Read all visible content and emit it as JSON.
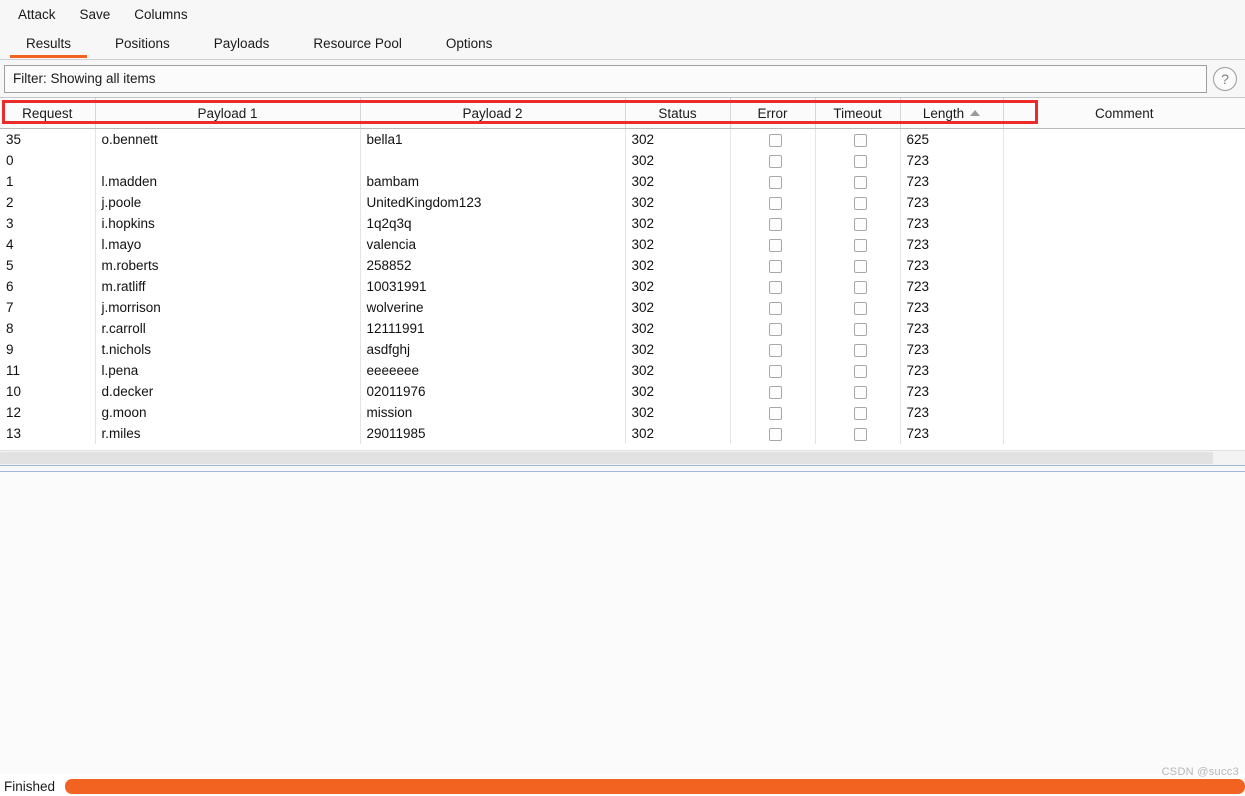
{
  "menubar": {
    "items": [
      {
        "label": "Attack",
        "name": "menu-attack"
      },
      {
        "label": "Save",
        "name": "menu-save"
      },
      {
        "label": "Columns",
        "name": "menu-columns"
      }
    ]
  },
  "tabs": {
    "items": [
      {
        "label": "Results",
        "active": true
      },
      {
        "label": "Positions",
        "active": false
      },
      {
        "label": "Payloads",
        "active": false
      },
      {
        "label": "Resource Pool",
        "active": false
      },
      {
        "label": "Options",
        "active": false
      }
    ],
    "active_accent": "#f26321"
  },
  "filter": {
    "text": "Filter: Showing all items",
    "help_icon": "question-mark-icon",
    "help_glyph": "?"
  },
  "table": {
    "columns": [
      {
        "label": "Request",
        "sort": ""
      },
      {
        "label": "Payload 1",
        "sort": ""
      },
      {
        "label": "Payload 2",
        "sort": ""
      },
      {
        "label": "Status",
        "sort": ""
      },
      {
        "label": "Error",
        "sort": ""
      },
      {
        "label": "Timeout",
        "sort": ""
      },
      {
        "label": "Length",
        "sort": "asc"
      },
      {
        "label": "Comment",
        "sort": ""
      }
    ],
    "rows": [
      {
        "request": "35",
        "payload1": "o.bennett",
        "payload2": "bella1",
        "status": "302",
        "error": false,
        "timeout": false,
        "length": "625",
        "comment": "",
        "highlighted": true
      },
      {
        "request": "0",
        "payload1": "",
        "payload2": "",
        "status": "302",
        "error": false,
        "timeout": false,
        "length": "723",
        "comment": "",
        "highlighted": false
      },
      {
        "request": "1",
        "payload1": "l.madden",
        "payload2": "bambam",
        "status": "302",
        "error": false,
        "timeout": false,
        "length": "723",
        "comment": "",
        "highlighted": false
      },
      {
        "request": "2",
        "payload1": "j.poole",
        "payload2": "UnitedKingdom123",
        "status": "302",
        "error": false,
        "timeout": false,
        "length": "723",
        "comment": "",
        "highlighted": false
      },
      {
        "request": "3",
        "payload1": "i.hopkins",
        "payload2": "1q2q3q",
        "status": "302",
        "error": false,
        "timeout": false,
        "length": "723",
        "comment": "",
        "highlighted": false
      },
      {
        "request": "4",
        "payload1": "l.mayo",
        "payload2": "valencia",
        "status": "302",
        "error": false,
        "timeout": false,
        "length": "723",
        "comment": "",
        "highlighted": false
      },
      {
        "request": "5",
        "payload1": "m.roberts",
        "payload2": "258852",
        "status": "302",
        "error": false,
        "timeout": false,
        "length": "723",
        "comment": "",
        "highlighted": false
      },
      {
        "request": "6",
        "payload1": "m.ratliff",
        "payload2": "10031991",
        "status": "302",
        "error": false,
        "timeout": false,
        "length": "723",
        "comment": "",
        "highlighted": false
      },
      {
        "request": "7",
        "payload1": "j.morrison",
        "payload2": "wolverine",
        "status": "302",
        "error": false,
        "timeout": false,
        "length": "723",
        "comment": "",
        "highlighted": false
      },
      {
        "request": "8",
        "payload1": "r.carroll",
        "payload2": "12111991",
        "status": "302",
        "error": false,
        "timeout": false,
        "length": "723",
        "comment": "",
        "highlighted": false
      },
      {
        "request": "9",
        "payload1": "t.nichols",
        "payload2": "asdfghj",
        "status": "302",
        "error": false,
        "timeout": false,
        "length": "723",
        "comment": "",
        "highlighted": false
      },
      {
        "request": "11",
        "payload1": "l.pena",
        "payload2": "eeeeeee",
        "status": "302",
        "error": false,
        "timeout": false,
        "length": "723",
        "comment": "",
        "highlighted": false
      },
      {
        "request": "10",
        "payload1": "d.decker",
        "payload2": "02011976",
        "status": "302",
        "error": false,
        "timeout": false,
        "length": "723",
        "comment": "",
        "highlighted": false
      },
      {
        "request": "12",
        "payload1": "g.moon",
        "payload2": "mission",
        "status": "302",
        "error": false,
        "timeout": false,
        "length": "723",
        "comment": "",
        "highlighted": false
      },
      {
        "request": "13",
        "payload1": "r.miles",
        "payload2": "29011985",
        "status": "302",
        "error": false,
        "timeout": false,
        "length": "723",
        "comment": "",
        "highlighted": false
      }
    ],
    "annotation_color": "#ee2b2b"
  },
  "statusbar": {
    "label": "Finished",
    "progress_color": "#f26321",
    "progress_percent": 100
  },
  "watermark": {
    "text": "CSDN @succ3"
  }
}
